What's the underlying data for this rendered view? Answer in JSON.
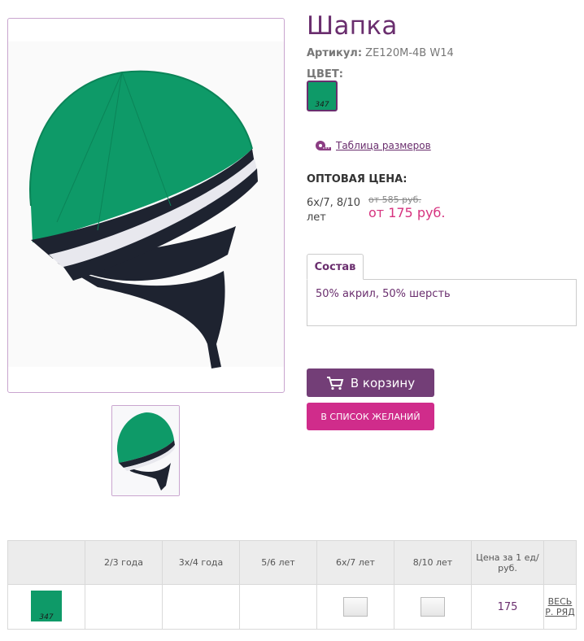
{
  "product": {
    "title": "Шапка",
    "article_label": "Артикул:",
    "article_value": "ZE120M-4B W14",
    "color_label": "ЦВЕТ:",
    "color_code": "347",
    "color_hex": "#0e9a68",
    "size_table_link": "Таблица размеров",
    "wholesale_label": "ОПТОВАЯ ЦЕНА:",
    "sizes_text": "6х/7, 8/10 лет",
    "old_price": "от 585 руб.",
    "price": "от 175 руб."
  },
  "tabs": {
    "composition_label": "Состав",
    "composition_text": "50% акрил, 50% шерсть"
  },
  "buttons": {
    "cart": "В корзину",
    "wishlist": "В СПИСОК ЖЕЛАНИЙ"
  },
  "table": {
    "headers": [
      "",
      "2/3 года",
      "3х/4 года",
      "5/6 лет",
      "6х/7 лет",
      "8/10 лет",
      "Цена за 1 ед/ руб.",
      ""
    ],
    "row": {
      "color_code": "347",
      "unit_price": "175",
      "link": "ВЕСЬ Р. РЯД"
    }
  },
  "colors": {
    "accent": "#6a2e6e",
    "pink": "#d02c8b",
    "button": "#733e77",
    "hat_green": "#0e9a68"
  },
  "icons": {
    "tape": "measuring-tape-icon",
    "cart": "shopping-cart-icon"
  }
}
